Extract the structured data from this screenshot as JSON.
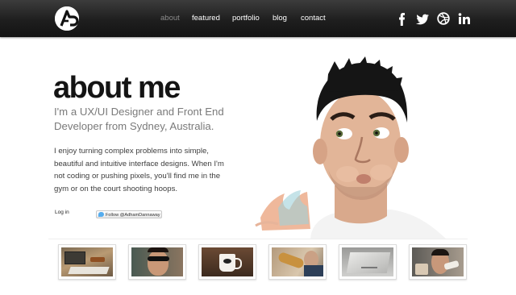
{
  "header": {
    "logo_icon": "ap-monogram-logo",
    "nav": [
      {
        "label": "about",
        "active": true
      },
      {
        "label": "featured",
        "active": false
      },
      {
        "label": "portfolio",
        "active": false
      },
      {
        "label": "blog",
        "active": false
      },
      {
        "label": "contact",
        "active": false
      }
    ],
    "social": [
      "facebook-icon",
      "twitter-icon",
      "dribbble-icon",
      "linkedin-icon"
    ]
  },
  "hero": {
    "title": "about me",
    "subtitle": "I'm a UX/UI Designer and Front End Developer from Sydney, Australia.",
    "body": "I enjoy turning complex problems into simple, beautiful and intuitive interface designs. When I'm not coding or pushing pixels, you'll find me in the gym or on the court shooting hoops.",
    "login_label": "Log in",
    "follow_label": "Follow @AdhamDannaway"
  },
  "colors": {
    "header_bg": "#1e1e1e",
    "nav_active": "#8c8c8c",
    "title": "#141414",
    "subtitle": "#7a7a7a"
  },
  "thumbnails": [
    {
      "icon": "desk-keyboard-photo"
    },
    {
      "icon": "sunglasses-photo"
    },
    {
      "icon": "coffee-mug-photo"
    },
    {
      "icon": "guitar-photo"
    },
    {
      "icon": "macbook-photo"
    },
    {
      "icon": "eating-photo"
    }
  ]
}
